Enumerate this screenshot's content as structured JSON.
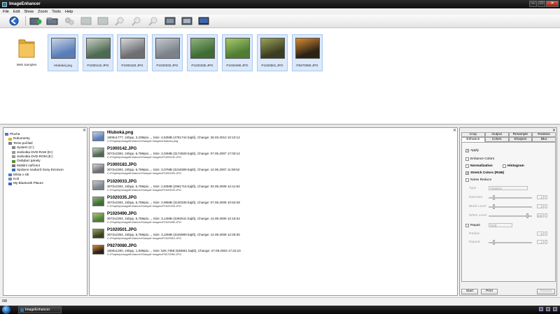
{
  "window": {
    "title": "ImageEnhancer"
  },
  "menu": [
    "File",
    "Edit",
    "Show",
    "Zoom",
    "Tools",
    "Help"
  ],
  "toolbar_icons": [
    "back-icon",
    "forward-icon",
    "open-folder-icon",
    "settings-icon",
    "image-prev-icon",
    "image-next-icon",
    "zoom-icon",
    "zoom-in-icon",
    "zoom-out-icon",
    "fit-icon",
    "fullscreen-icon",
    "display-icon"
  ],
  "thumbnails": [
    {
      "label": "Web Samples",
      "kind": "folder"
    },
    {
      "label": "Hluboká.png",
      "kind": "image",
      "color1": "#5a7db8",
      "color2": "#c9d4e6"
    },
    {
      "label": "P1000142.JPG",
      "kind": "image",
      "color1": "#4d6a52",
      "color2": "#c8cfc4"
    },
    {
      "label": "P1000183.JPG",
      "kind": "image",
      "color1": "#6d6f73",
      "color2": "#d6d8dc"
    },
    {
      "label": "P1020033.JPG",
      "kind": "image",
      "color1": "#7b8289",
      "color2": "#c3c9cf"
    },
    {
      "label": "P1020335.JPG",
      "kind": "image",
      "color1": "#3f6b35",
      "color2": "#90b37c"
    },
    {
      "label": "P1020490.JPG",
      "kind": "image",
      "color1": "#4f7d32",
      "color2": "#a9c86f"
    },
    {
      "label": "P1020501.JPG",
      "kind": "image",
      "color1": "#3a3d22",
      "color2": "#9aa257"
    },
    {
      "label": "P9270080.JPG",
      "kind": "image",
      "color1": "#2b2216",
      "color2": "#d98b33"
    }
  ],
  "tree": [
    {
      "label": "Plocha",
      "indent": 0
    },
    {
      "label": "Dokumenty",
      "indent": 1
    },
    {
      "label": "Tento počítač",
      "indent": 1
    },
    {
      "label": "System (C:)",
      "indent": 2
    },
    {
      "label": "Jednotka DVD-RAM (D:)",
      "indent": 2
    },
    {
      "label": "Jednotka DVD-ROM (E:)",
      "indent": 2
    },
    {
      "label": "Ovládací panely",
      "indent": 2
    },
    {
      "label": "Mobilní zařízení",
      "indent": 2
    },
    {
      "label": "Správce souborů Sony Ericsson",
      "indent": 2
    },
    {
      "label": "Místa v síti",
      "indent": 1
    },
    {
      "label": "Koš",
      "indent": 1
    },
    {
      "label": "My Bluetooth Places",
      "indent": 1
    }
  ],
  "files": [
    {
      "name": "Hluboká.png",
      "info": "1905x1777, 24bpp, 3,23Mpix..., Size: 4,53MB (4751744 bajtů), Change: 26.03.2010 10:10:12",
      "path": "C:\\Projekty\\ImageEnhancer\\Sample Images\\Hluboká.png",
      "c1": "#5a7db8",
      "c2": "#c9d4e6"
    },
    {
      "name": "P1000142.JPG",
      "info": "3072x2304, 24bpp, 6,75Mpix..., Size: 3,03MB (3174828 bajtů), Change: 07.05.2007 17:00:12",
      "path": "C:\\Projekty\\ImageEnhancer\\Sample Images\\P1000142.JPG",
      "c1": "#4d6a52",
      "c2": "#c8cfc4"
    },
    {
      "name": "P1000183.JPG",
      "info": "3072x2304, 24bpp, 6,75Mpix..., Size: 3,07MB (3218389 bajtů), Change: 12.05.2007 11:09:52",
      "path": "C:\\Projekty\\ImageEnhancer\\Sample Images\\P1000183.JPG",
      "c1": "#6d6f73",
      "c2": "#d6d8dc"
    },
    {
      "name": "P1020033.JPG",
      "info": "3072x2304, 24bpp, 6,75Mpix..., Size: 2,83MB (2961716 bajtů), Change: 02.05.2009 12:41:52",
      "path": "C:\\Projekty\\ImageEnhancer\\Sample Images\\P1020033.JPG",
      "c1": "#7b8289",
      "c2": "#c3c9cf"
    },
    {
      "name": "P1020335.JPG",
      "info": "3072x2304, 24bpp, 6,75Mpix..., Size: 2,99MB (3130338 bajtů), Change: 07.06.2009 10:53:28",
      "path": "C:\\Projekty\\ImageEnhancer\\Sample Images\\P1020335.JPG",
      "c1": "#3f6b35",
      "c2": "#90b37c"
    },
    {
      "name": "P1020490.JPG",
      "info": "3072x2304, 24bpp, 6,75Mpix..., Size: 3,14MB (3292541 bajtů), Change: 14.08.2009 12:18:34",
      "path": "C:\\Projekty\\ImageEnhancer\\Sample Images\\P1020490.JPG",
      "c1": "#4f7d32",
      "c2": "#a9c86f"
    },
    {
      "name": "P1020501.JPG",
      "info": "3072x2304, 24bpp, 6,75Mpix..., Size: 3,10MB (3245989 bajtů), Change: 14.08.2009 12:29:30",
      "path": "C:\\Projekty\\ImageEnhancer\\Sample Images\\P1020501.JPG",
      "c1": "#3a3d22",
      "c2": "#9aa257"
    },
    {
      "name": "P9270080.JPG",
      "info": "1600x1200, 24bpp, 1,83Mpix..., Size: 525,74kB (538361 bajtů), Change: 27.09.2003 17:22:10",
      "path": "C:\\Projekty\\ImageEnhancer\\Sample Images\\P9270080.JPG",
      "c1": "#2b2216",
      "c2": "#d98b33"
    }
  ],
  "right_panel": {
    "tabs_row1": [
      "Crop",
      "Output",
      "Resample",
      "Rotation"
    ],
    "tabs_row2": [
      "Enhance",
      "Colors",
      "Sharpen",
      "Blur"
    ],
    "active_tab": "Enhance",
    "apply": "Apply",
    "enhance_colors": "Enhance Colors",
    "normalization": "Normalization",
    "histogram": "Histogram",
    "stretch_colors": "Stretch Colors (RGB)",
    "noise_reduce": "Noise Reduce",
    "type_label": "Type",
    "type_value": "Adaptive",
    "diameter_label": "Diameter",
    "diameter_value": "5",
    "black_level_label": "Black Level",
    "black_level_value": "5",
    "white_level_label": "White Level",
    "white_level_value": "240",
    "repair_label": "Repair",
    "repair_value": "RGB",
    "radius_label": "Radius",
    "radius_value": "5",
    "repeat_label": "Repeat",
    "repeat_value": "1",
    "start_btn": "Start",
    "print_btn": "Print",
    "preview_btn": "Preview"
  },
  "status": {
    "text": "0/8"
  },
  "taskbar": {
    "task": "ImageEnhancer",
    "time": ""
  }
}
